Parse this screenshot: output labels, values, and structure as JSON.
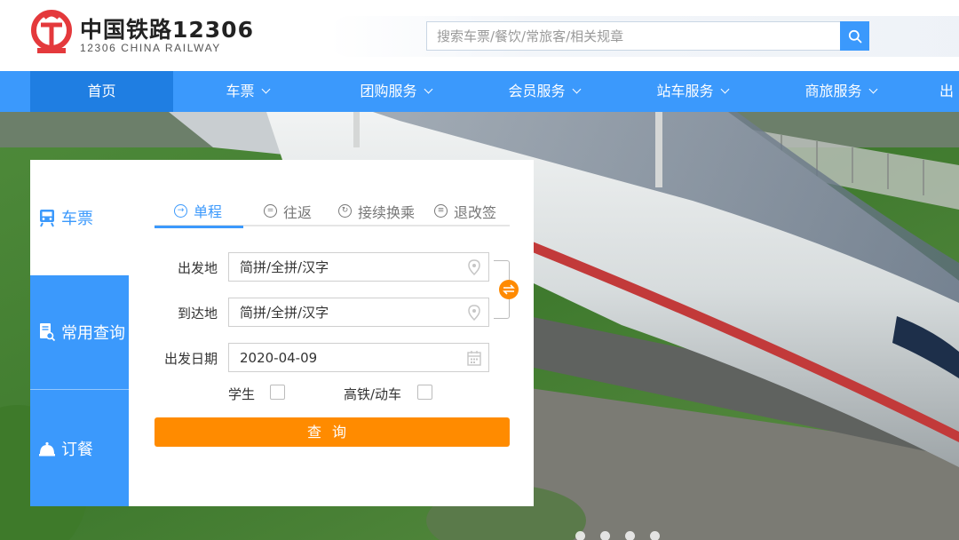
{
  "header": {
    "brand_title": "中国铁路12306",
    "brand_subtitle": "12306 CHINA RAILWAY",
    "search_placeholder": "搜索车票/餐饮/常旅客/相关规章"
  },
  "nav": {
    "items": [
      {
        "label": "首页",
        "dropdown": false,
        "active": true
      },
      {
        "label": "车票",
        "dropdown": true
      },
      {
        "label": "团购服务",
        "dropdown": true
      },
      {
        "label": "会员服务",
        "dropdown": true
      },
      {
        "label": "站车服务",
        "dropdown": true
      },
      {
        "label": "商旅服务",
        "dropdown": true
      },
      {
        "label": "出",
        "dropdown": false
      }
    ]
  },
  "booking": {
    "side": [
      {
        "label": "车票",
        "icon": "train-icon",
        "active": true
      },
      {
        "label": "常用查询",
        "icon": "document-search-icon"
      },
      {
        "label": "订餐",
        "icon": "dining-bell-icon"
      }
    ],
    "tabs": [
      {
        "label": "单程",
        "icon": "arrow-circle-icon",
        "active": true
      },
      {
        "label": "往返",
        "icon": "equal-circle-icon"
      },
      {
        "label": "接续换乘",
        "icon": "cycle-circle-icon"
      },
      {
        "label": "退改签",
        "icon": "ticket-circle-icon"
      }
    ],
    "from_label": "出发地",
    "from_placeholder": "简拼/全拼/汉字",
    "to_label": "到达地",
    "to_placeholder": "简拼/全拼/汉字",
    "date_label": "出发日期",
    "date_value": "2020-04-09",
    "student_label": "学生",
    "highspeed_label": "高铁/动车",
    "query_label": "查询"
  },
  "colors": {
    "brand_blue": "#3b99fc",
    "nav_active": "#1f7ee2",
    "accent_orange": "#ff8b00",
    "logo_red": "#e4393c"
  },
  "carousel": {
    "slides": 4,
    "active": 0
  }
}
